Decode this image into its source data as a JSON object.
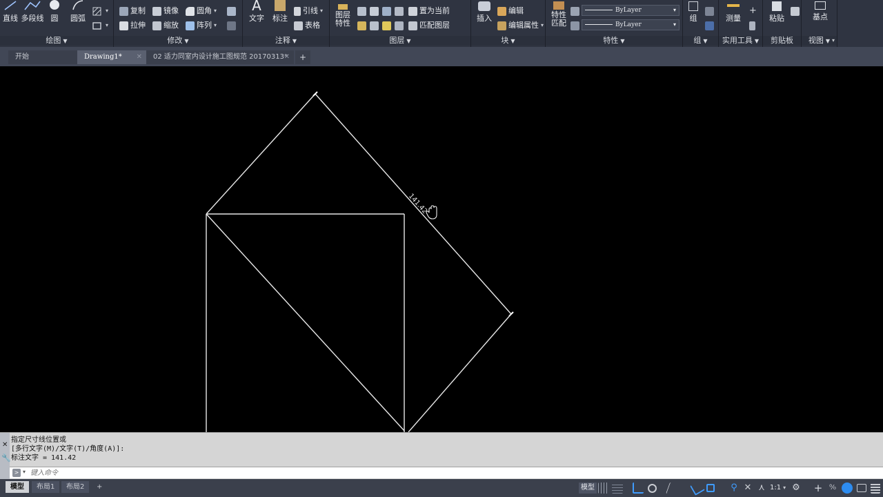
{
  "ribbon": {
    "draw": {
      "title": "绘图",
      "line": "直线",
      "polyline": "多段线",
      "circle": "圆",
      "arc": "圆弧"
    },
    "modify": {
      "title": "修改",
      "copy": "复制",
      "mirror": "镜像",
      "fillet": "圆角",
      "stretch": "拉伸",
      "scale": "缩放",
      "array": "阵列"
    },
    "annotation": {
      "title": "注释",
      "text": "文字",
      "dimension": "标注",
      "leader": "引线",
      "table": "表格"
    },
    "layers": {
      "title": "图层",
      "properties": "图层\n特性",
      "set_current": "置为当前",
      "match_layer": "匹配图层"
    },
    "block": {
      "title": "块",
      "insert": "插入",
      "edit": "编辑",
      "edit_attributes": "编辑属性"
    },
    "properties": {
      "title": "特性",
      "match": "特性\n匹配",
      "linetype_value": "ByLayer",
      "lineweight_value": "ByLayer"
    },
    "groups": {
      "title": "组",
      "group": "组"
    },
    "utilities": {
      "title": "实用工具",
      "measure": "测量"
    },
    "clipboard": {
      "title": "剪贴板",
      "paste": "粘贴"
    },
    "view": {
      "title": "视图",
      "base": "基点"
    }
  },
  "file_tabs": [
    {
      "label": "开始"
    },
    {
      "label": "Drawing1*"
    },
    {
      "label": "02 适力同室内设计施工图规范 20170313*"
    }
  ],
  "drawing": {
    "dimension_text": "141.42"
  },
  "command_line": {
    "history": [
      "指定尺寸线位置或",
      "[多行文字(M)/文字(T)/角度(A)]:",
      "标注文字 = 141.42"
    ],
    "input_placeholder": "键入命令"
  },
  "layout_tabs": [
    {
      "label": "模型"
    },
    {
      "label": "布局1"
    },
    {
      "label": "布局2"
    }
  ],
  "status_bar": {
    "model_label": "模型",
    "scale_label": "1:1"
  },
  "icons": {
    "add_tab": "plus-icon",
    "pan_cursor": "hand-cursor-icon",
    "close": "close-icon"
  },
  "colors": {
    "ribbon_bg": "#2f3441",
    "canvas_bg": "#000000",
    "geometry": "#e8e8e8",
    "accent_blue": "#2d8cf0",
    "command_bg": "#d5d5d5"
  }
}
